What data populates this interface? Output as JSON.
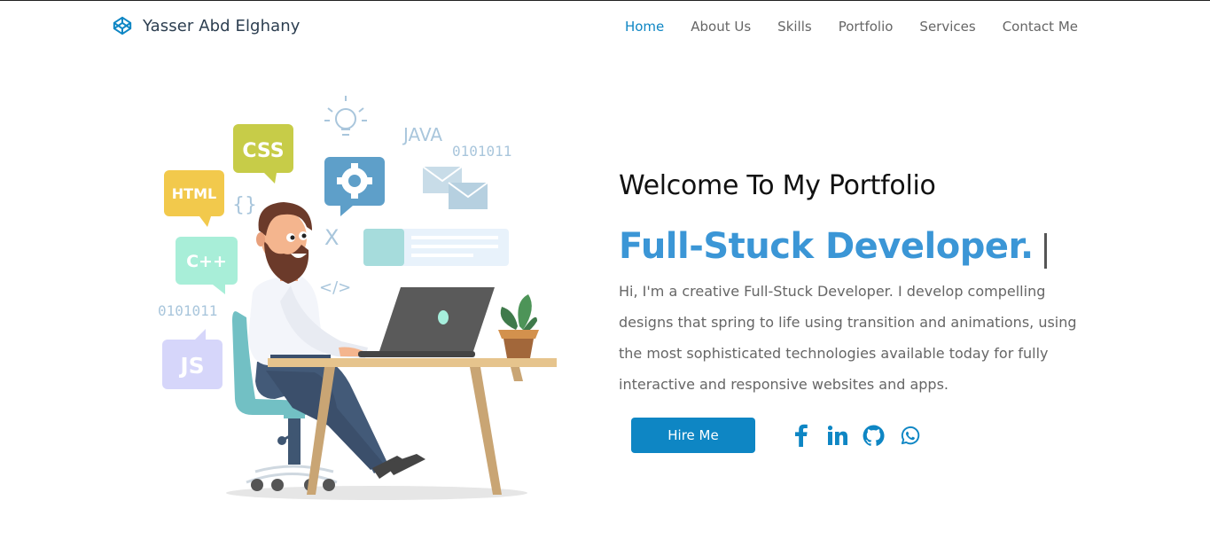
{
  "brand": {
    "name": "Yasser Abd Elghany",
    "icon": "codepen-icon"
  },
  "nav": {
    "items": [
      {
        "label": "Home",
        "active": true
      },
      {
        "label": "About Us",
        "active": false
      },
      {
        "label": "Skills",
        "active": false
      },
      {
        "label": "Portfolio",
        "active": false
      },
      {
        "label": "Services",
        "active": false
      },
      {
        "label": "Contact Me",
        "active": false
      }
    ]
  },
  "hero": {
    "welcome": "Welcome To My Portfolio",
    "role": "Full-Stuck Developer.",
    "description": "Hi, I'm a creative Full-Stuck Developer. I develop compelling designs that spring to life using transition and animations, using the most sophisticated technologies available today for fully interactive and responsive websites and apps.",
    "hire_label": "Hire Me"
  },
  "illustration": {
    "bubbles": [
      "CSS",
      "HTML",
      "C++",
      "JS"
    ],
    "tags": [
      "JAVA",
      "0101011",
      "0101011",
      "{}",
      "X",
      "</>"
    ]
  },
  "socials": [
    "facebook-icon",
    "linkedin-icon",
    "github-icon",
    "whatsapp-icon"
  ],
  "colors": {
    "accent": "#0e86c4",
    "role": "#3b96d6",
    "text": "#666666"
  }
}
